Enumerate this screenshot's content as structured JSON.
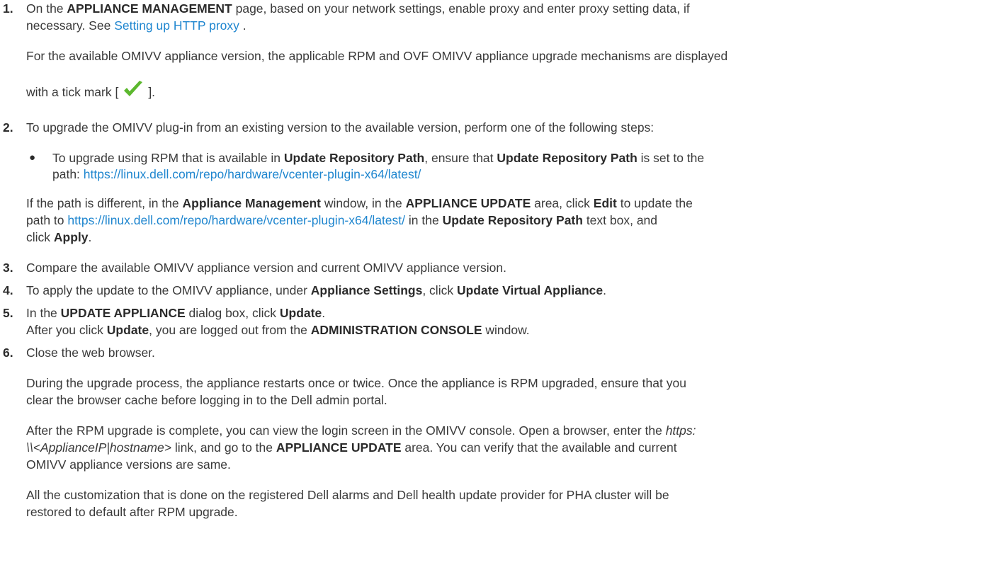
{
  "steps": [
    {
      "num": "1.",
      "l1_a": "On the ",
      "l1_b": "APPLIANCE MANAGEMENT",
      "l1_c": " page, based on your network settings, enable proxy and enter proxy setting data, if",
      "l2_a": "necessary. See ",
      "l2_link": "Setting up HTTP proxy",
      "l2_c": " .",
      "p1": "For the available OMIVV appliance version, the applicable RPM and OVF OMIVV appliance upgrade mechanisms are displayed",
      "p2_a": "with a tick mark [",
      "p2_b": "]."
    },
    {
      "num": "2.",
      "l1": "To upgrade the OMIVV plug-in from an existing version to the available version, perform one of the following steps:",
      "bullet_char": "●",
      "b1_a": "To upgrade using RPM that is available in ",
      "b1_b": "Update Repository Path",
      "b1_c": ", ensure that ",
      "b1_d": "Update Repository Path",
      "b1_e": " is set to the",
      "b2_a": "path: ",
      "b2_link": "https://linux.dell.com/repo/hardware/vcenter-plugin-x64/latest/",
      "p1_a": "If the path is different, in the ",
      "p1_b": "Appliance Management",
      "p1_c": " window, in the ",
      "p1_d": "APPLIANCE UPDATE",
      "p1_e": " area, click ",
      "p1_f": "Edit",
      "p1_g": " to update the",
      "p2_a": "path to ",
      "p2_link": "https://linux.dell.com/repo/hardware/vcenter-plugin-x64/latest/",
      "p2_c": " in the ",
      "p2_d": "Update Repository Path",
      "p2_e": " text box, and",
      "p3_a": "click ",
      "p3_b": "Apply",
      "p3_c": "."
    },
    {
      "num": "3.",
      "l1": "Compare the available OMIVV appliance version and current OMIVV appliance version."
    },
    {
      "num": "4.",
      "l1_a": "To apply the update to the OMIVV appliance, under ",
      "l1_b": "Appliance Settings",
      "l1_c": ", click ",
      "l1_d": "Update Virtual Appliance",
      "l1_e": "."
    },
    {
      "num": "5.",
      "l1_a": "In the ",
      "l1_b": "UPDATE APPLIANCE",
      "l1_c": " dialog box, click ",
      "l1_d": "Update",
      "l1_e": ".",
      "l2_a": "After you click ",
      "l2_b": "Update",
      "l2_c": ", you are logged out from the ",
      "l2_d": "ADMINISTRATION CONSOLE",
      "l2_e": " window."
    },
    {
      "num": "6.",
      "l1": "Close the web browser.",
      "p1_1": "During the upgrade process, the appliance restarts once or twice. Once the appliance is RPM upgraded, ensure that you",
      "p1_2": "clear the browser cache before logging in to the Dell admin portal.",
      "p2_1a": "After the RPM upgrade is complete, you can view the login screen in the OMIVV console. Open a browser, enter the ",
      "p2_1b": "https:",
      "p2_2a": "\\\\<ApplianceIP|hostname>",
      "p2_2b": " link, and go to the ",
      "p2_2c": "APPLIANCE UPDATE",
      "p2_2d": " area. You can verify that the available and current",
      "p2_3": "OMIVV appliance versions are same.",
      "p3_1": "All the customization that is done on the registered Dell alarms and Dell health update provider for PHA cluster will be",
      "p3_2": "restored to default after RPM upgrade."
    }
  ],
  "colors": {
    "text": "#3a3a3a",
    "link": "#1f86cf",
    "tick": "#5cb82e"
  },
  "icons": {
    "tick": "check-mark-icon"
  }
}
